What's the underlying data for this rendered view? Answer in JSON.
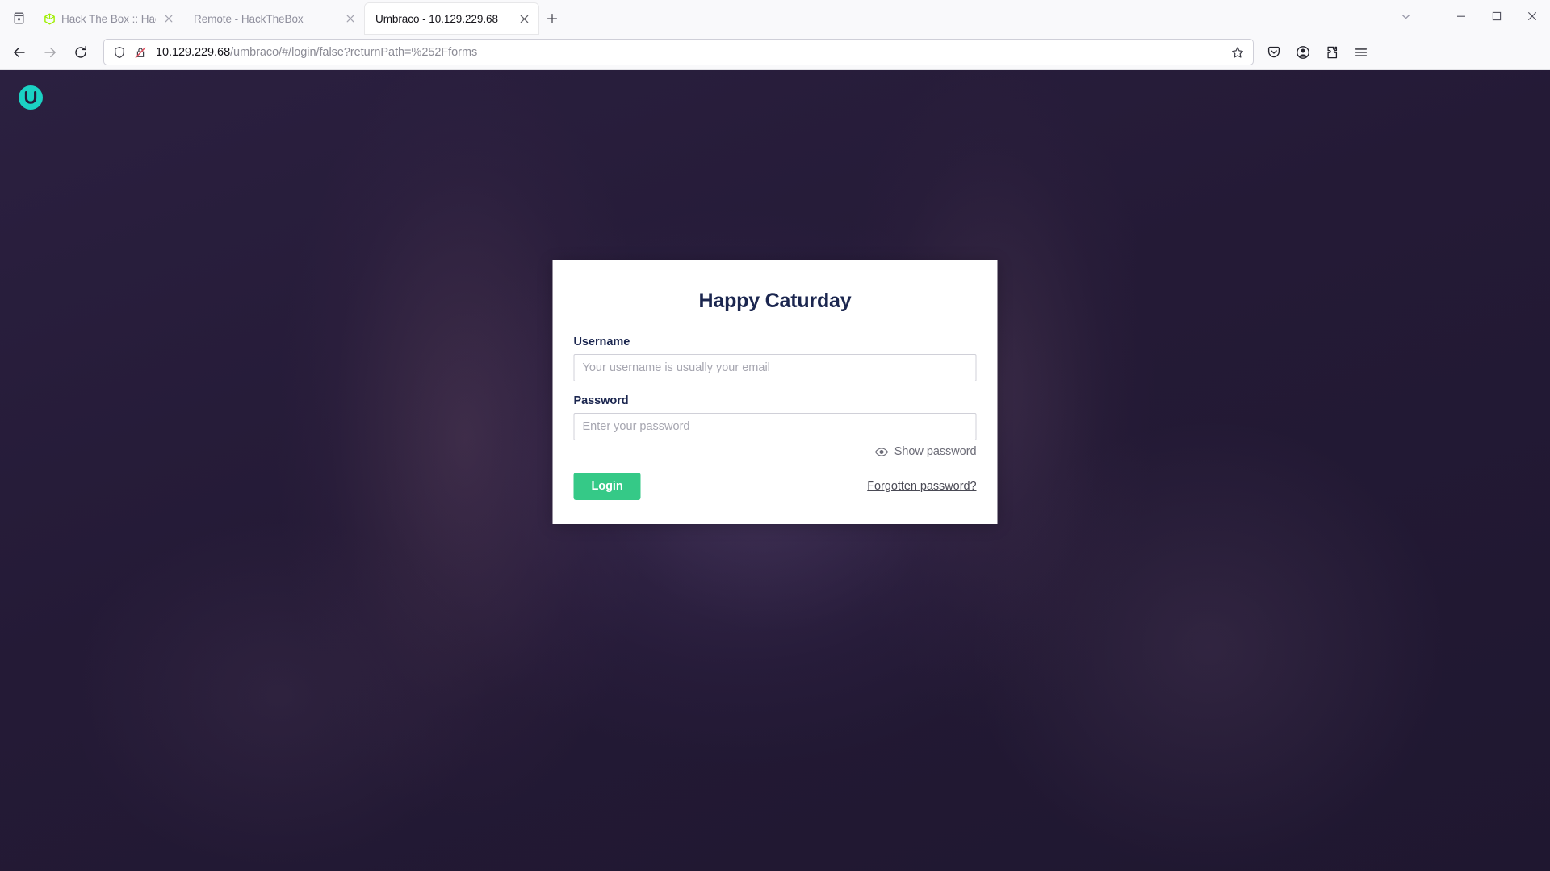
{
  "browser": {
    "tab_list_icon": "tab-list-icon",
    "new_tab_label": "+",
    "tabs": [
      {
        "title": "Hack The Box :: Hack The",
        "favicon": "hackthebox-cube-icon",
        "active": false,
        "close_label": "✕"
      },
      {
        "title": "Remote - HackTheBox",
        "favicon": "none",
        "active": false,
        "close_label": "✕"
      },
      {
        "title": "Umbraco - 10.129.229.68",
        "favicon": "none",
        "active": true,
        "close_label": "✕"
      }
    ],
    "window_controls": {
      "list_all_tabs": "chevron-down-icon",
      "minimize": "minimize-icon",
      "maximize": "maximize-icon",
      "close": "close-icon"
    },
    "nav": {
      "back": "back-arrow-icon",
      "forward": "forward-arrow-icon",
      "reload": "reload-icon"
    },
    "url": {
      "host": "10.129.229.68",
      "path": "/umbraco/#/login/false?returnPath=%252Fforms",
      "full": "10.129.229.68/umbraco/#/login/false?returnPath=%252Fforms",
      "shield_icon": "tracking-protection-shield-icon",
      "lock_icon": "insecure-connection-icon",
      "bookmark_icon": "bookmark-star-icon"
    },
    "toolbar": {
      "pocket": "save-to-pocket-icon",
      "account": "firefox-account-icon",
      "extensions": "extensions-puzzle-icon",
      "menu": "application-menu-icon"
    }
  },
  "page": {
    "product": "Umbraco",
    "logo": "umbraco-logo-icon",
    "logo_color": "#1bd1c3",
    "background_color": "#241a38",
    "login": {
      "title": "Happy Caturday",
      "username": {
        "label": "Username",
        "placeholder": "Your username is usually your email",
        "value": ""
      },
      "password": {
        "label": "Password",
        "placeholder": "Enter your password",
        "value": ""
      },
      "show_password_label": "Show password",
      "show_password_icon": "eye-icon",
      "login_button_label": "Login",
      "login_button_color": "#35c987",
      "forgot_password_label": "Forgotten password?"
    }
  }
}
